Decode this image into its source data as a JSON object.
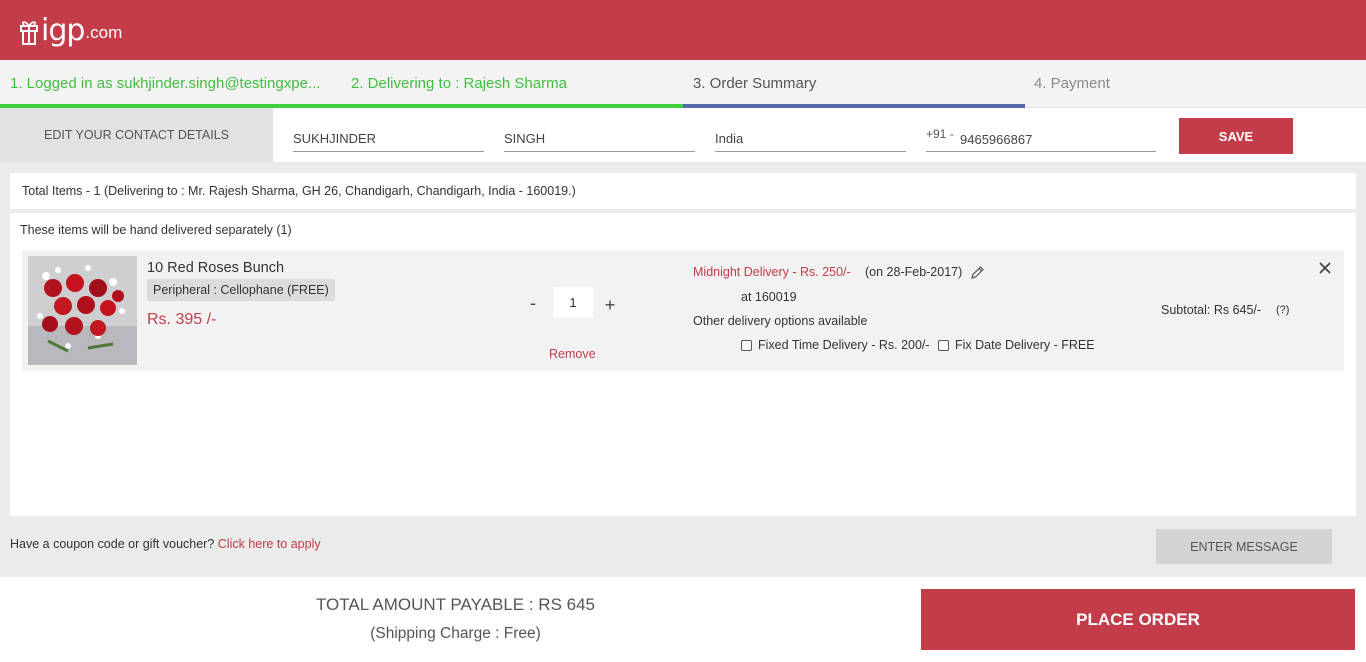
{
  "brand": {
    "logo_main": "igp",
    "logo_tld": ".com"
  },
  "colors": {
    "brand_red": "#c23c4a",
    "step_done_green": "#3fbf3f",
    "step_active_blue": "#5569a8"
  },
  "steps": [
    {
      "label": "1. Logged in as sukhjinder.singh@testingxpe...",
      "state": "done"
    },
    {
      "label": "2. Delivering to : Rajesh Sharma",
      "state": "done"
    },
    {
      "label": "3. Order Summary",
      "state": "active"
    },
    {
      "label": "4. Payment",
      "state": "todo"
    }
  ],
  "contact": {
    "label": "EDIT YOUR CONTACT DETAILS",
    "first_name": "SUKHJINDER",
    "last_name": "SINGH",
    "country": "India",
    "phone_code": "+91 -",
    "phone": "9465966867",
    "save_label": "SAVE"
  },
  "summary": "Total Items - 1 (Delivering to : Mr. Rajesh Sharma, GH 26, Chandigarh, Chandigarh, India - 160019.)",
  "items_note": "These items will be hand delivered separately (1)",
  "item": {
    "name": "10 Red Roses Bunch",
    "peripheral": "Peripheral : Cellophane (FREE)",
    "price": "Rs. 395 /-",
    "qty_minus": "-",
    "quantity": "1",
    "qty_plus": "+",
    "remove_label": "Remove",
    "delivery_type": "Midnight Delivery - Rs. 250/-",
    "delivery_date": "(on 28-Feb-2017)",
    "delivery_pin": "at 160019",
    "other_options_label": "Other delivery options available",
    "options": [
      "Fixed Time Delivery - Rs. 200/-",
      "Fix Date Delivery - FREE"
    ],
    "subtotal": "Subtotal: Rs 645/-",
    "help": "(?)"
  },
  "coupon": {
    "text": "Have a coupon code or gift voucher?",
    "link": "Click here to apply"
  },
  "enter_message_label": "ENTER MESSAGE",
  "footer": {
    "total": "TOTAL AMOUNT PAYABLE : RS 645",
    "shipping": "(Shipping Charge : Free)",
    "place_order_label": "PLACE ORDER"
  },
  "icons": [
    "gift-logo-icon",
    "pencil-icon",
    "close-icon",
    "checkbox-icon",
    "roses-image"
  ]
}
